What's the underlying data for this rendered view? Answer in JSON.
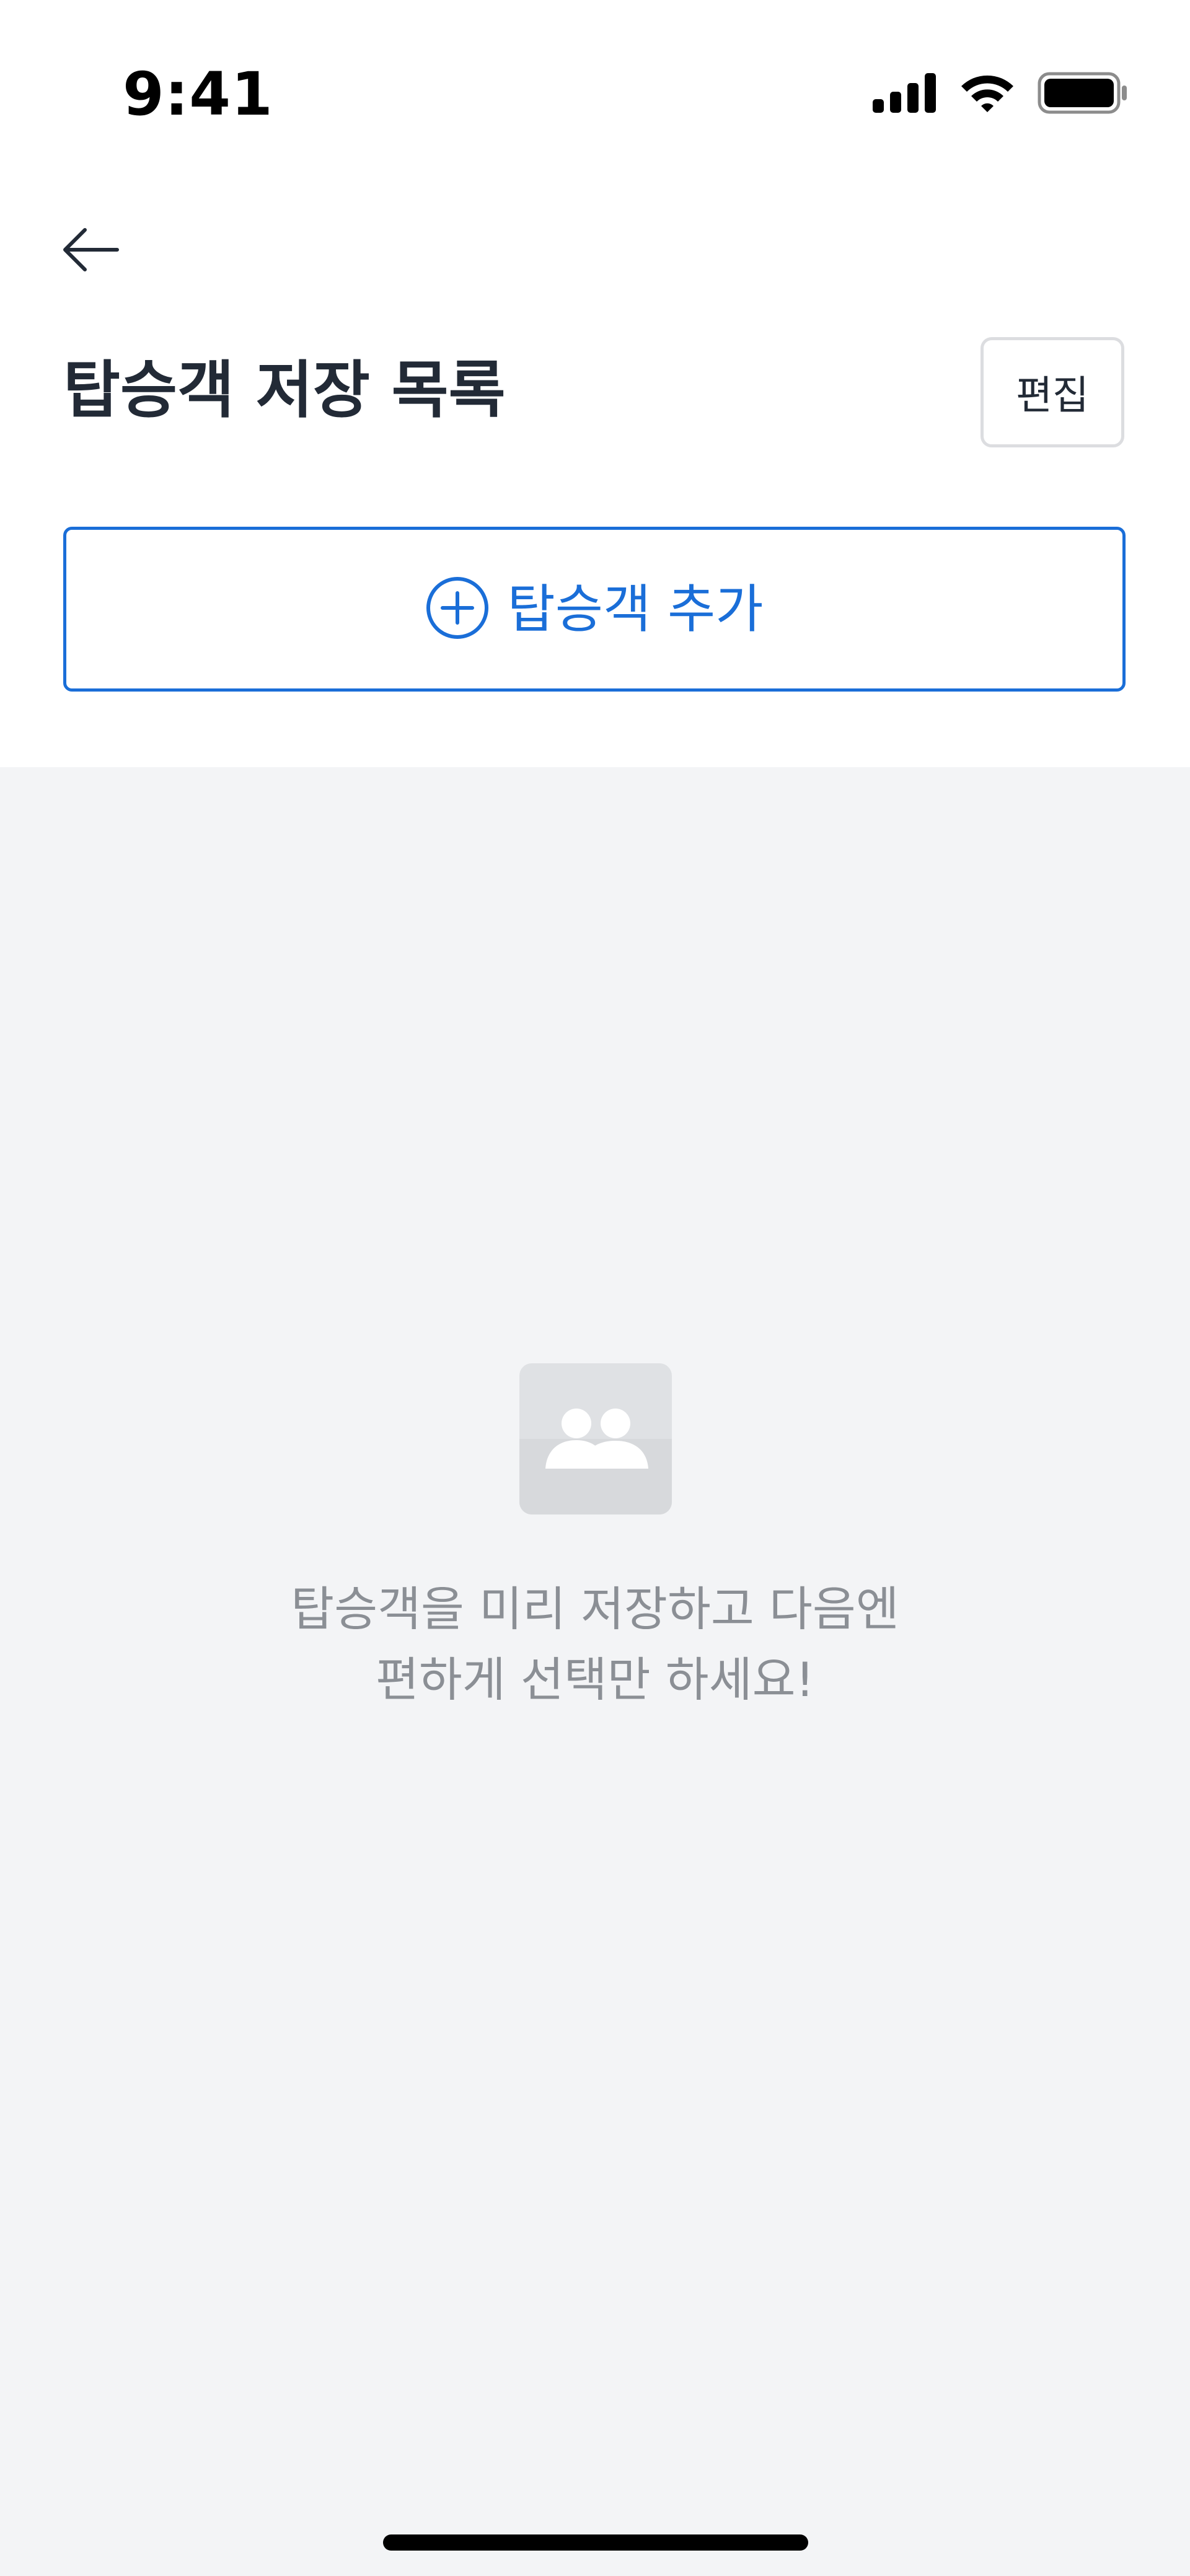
{
  "status_bar": {
    "time": "9:41",
    "icons": [
      "cellular-signal-icon",
      "wifi-icon",
      "battery-icon"
    ]
  },
  "nav": {
    "back_icon": "arrow-left-icon"
  },
  "header": {
    "title": "탑승객 저장 목록",
    "edit_label": "편집"
  },
  "actions": {
    "add_passenger_label": "탑승객 추가",
    "add_icon": "plus-circle-icon"
  },
  "empty_state": {
    "icon": "people-icon",
    "message_line1": "탑승객을 미리 저장하고 다음엔",
    "message_line2": "편하게 선택만 하세요!"
  },
  "colors": {
    "accent": "#1a6ed8",
    "title_text": "#222a36",
    "muted_text": "#8b8f95",
    "background": "#f3f4f6",
    "surface": "#ffffff"
  }
}
